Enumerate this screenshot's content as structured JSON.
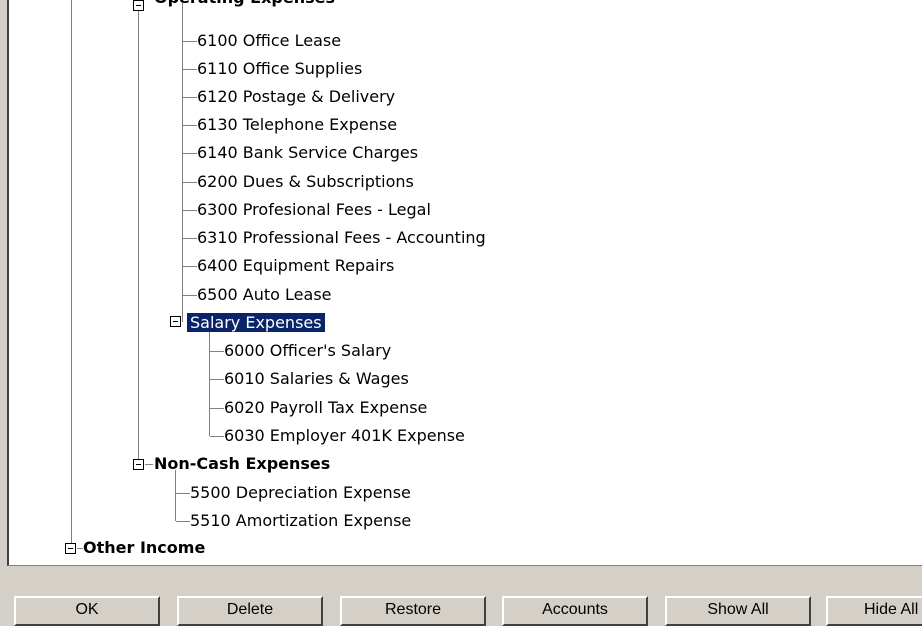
{
  "tree": {
    "operating_expenses_label": "Operating Expenses",
    "operating_items": [
      "6100  Office Lease",
      "6110  Office Supplies",
      "6120  Postage & Delivery",
      "6130  Telephone Expense",
      "6140  Bank Service Charges",
      "6200  Dues & Subscriptions",
      "6300  Profesional Fees - Legal",
      "6310  Professional Fees - Accounting",
      "6400  Equipment Repairs",
      "6500  Auto Lease"
    ],
    "salary_group_label": "Salary Expenses",
    "salary_items": [
      "6000  Officer's Salary",
      "6010  Salaries & Wages",
      "6020  Payroll Tax Expense",
      "6030  Employer 401K Expense"
    ],
    "noncash_group_label": "Non-Cash Expenses",
    "noncash_items": [
      "5500  Depreciation Expense",
      "5510  Amortization Expense"
    ],
    "other_income_label": "Other Income"
  },
  "buttons": {
    "ok": "OK",
    "delete": "Delete",
    "restore": "Restore",
    "accounts": "Accounts",
    "show_all": "Show All",
    "hide_all": "Hide All"
  }
}
